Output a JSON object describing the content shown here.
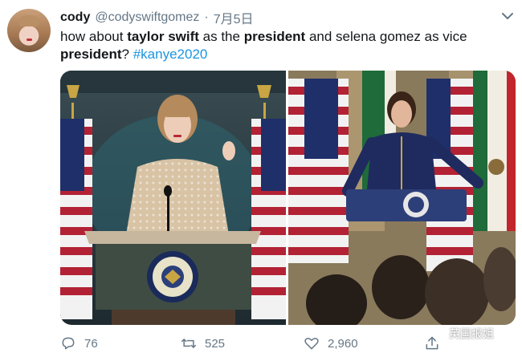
{
  "tweet": {
    "display_name": "cody",
    "handle": "@codyswiftgomez",
    "separator": "·",
    "date": "7月5日",
    "text_parts": [
      {
        "text": "how about ",
        "bold": false
      },
      {
        "text": "taylor swift",
        "bold": true
      },
      {
        "text": " as the ",
        "bold": false
      },
      {
        "text": "president",
        "bold": true
      },
      {
        "text": " and selena gomez as vice ",
        "bold": false
      },
      {
        "text": "president",
        "bold": true
      },
      {
        "text": "? ",
        "bold": false
      }
    ],
    "hashtag": "#kanye2020"
  },
  "actions": {
    "reply_count": "76",
    "retweet_count": "525",
    "like_count": "2,960"
  },
  "watermark": {
    "text": "英国报姐"
  },
  "colors": {
    "link": "#1b95e0",
    "muted": "#657786",
    "text": "#14171a"
  },
  "icons": {
    "more": "chevron-down-icon",
    "reply": "reply-icon",
    "retweet": "retweet-icon",
    "like": "heart-icon",
    "share": "share-icon"
  }
}
